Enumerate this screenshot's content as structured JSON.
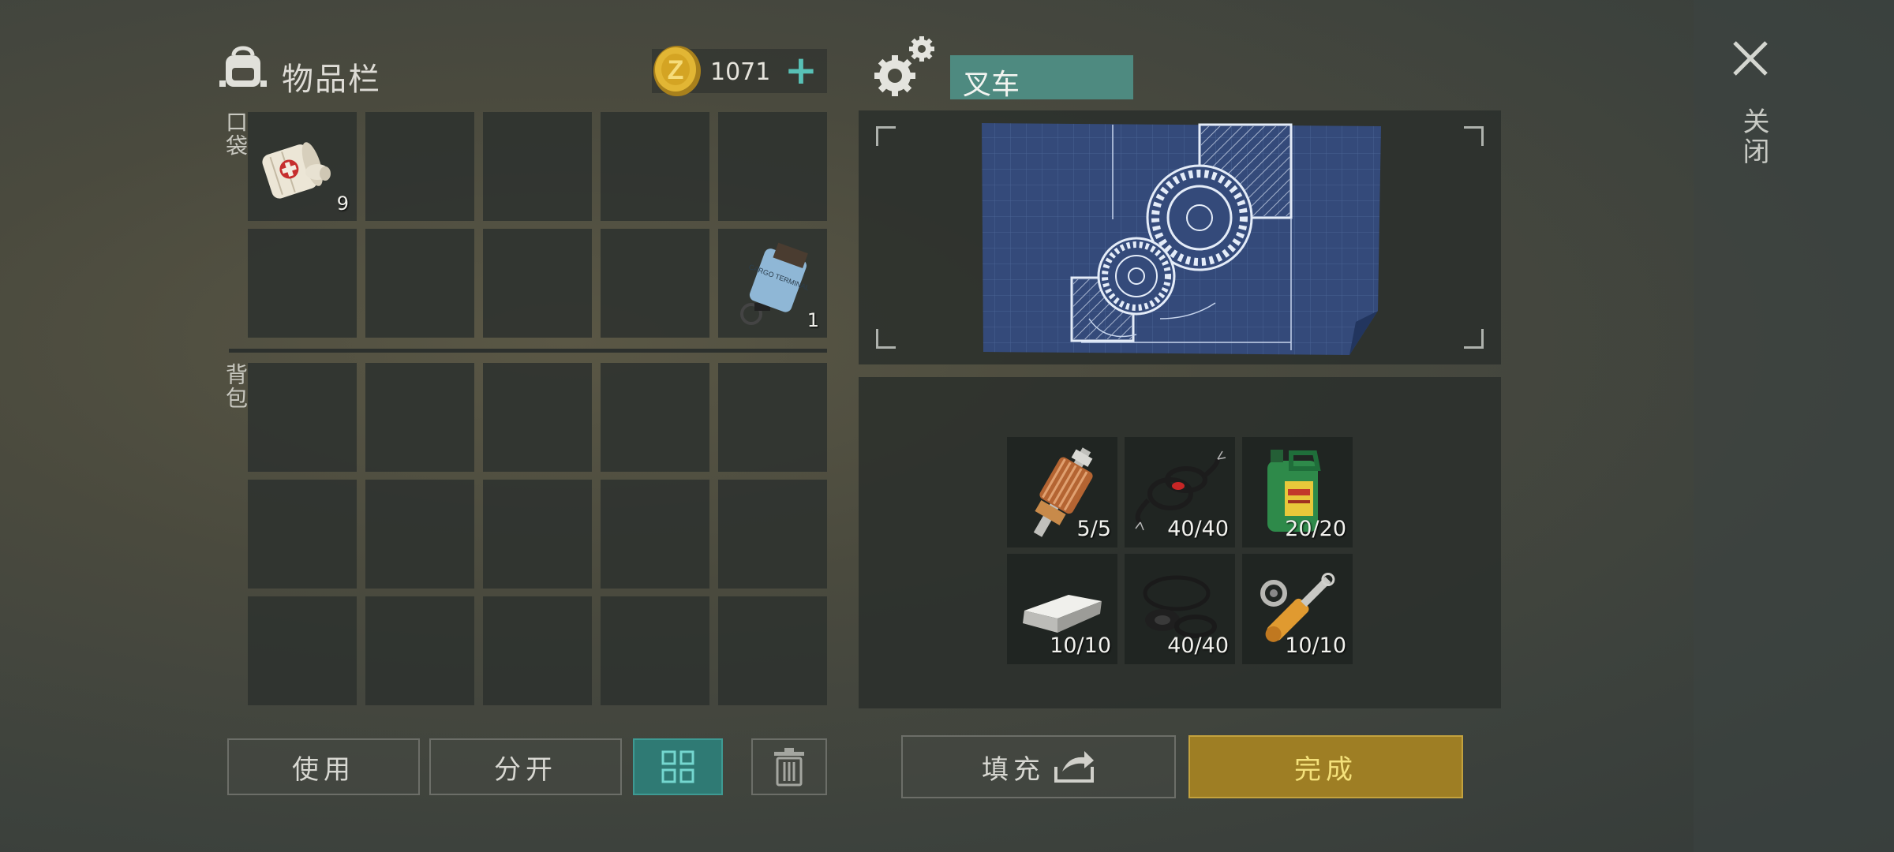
{
  "inventory": {
    "title": "物品栏",
    "coins": "1071",
    "pocket_label": "口袋",
    "backpack_label": "背包"
  },
  "pocket_items": [
    {
      "icon": "bandage-icon",
      "count": "9"
    },
    {
      "icon": "cargo-terminal-keycard-icon",
      "count": "1",
      "text": "CARGO TERMINAL"
    }
  ],
  "buttons": {
    "use": "使用",
    "split": "分开",
    "fill": "填充",
    "complete": "完成"
  },
  "craft": {
    "name": "叉车",
    "ingredients": [
      {
        "icon": "electric-motor-armature-icon",
        "count": "5/5"
      },
      {
        "icon": "wires-icon",
        "count": "40/40"
      },
      {
        "icon": "motor-oil-canister-icon",
        "count": "20/20"
      },
      {
        "icon": "metal-ingot-icon",
        "count": "10/10"
      },
      {
        "icon": "rubber-seals-icon",
        "count": "40/40"
      },
      {
        "icon": "hydraulic-cylinder-icon",
        "count": "10/10"
      }
    ]
  },
  "close_label": "关闭",
  "colors": {
    "accent_teal": "#4e8a80",
    "complete_gold": "#b08e2c",
    "plus_teal": "#58c1b6"
  }
}
